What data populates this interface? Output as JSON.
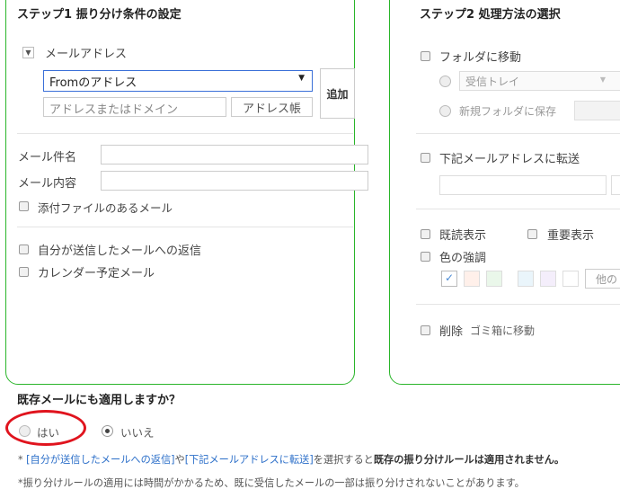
{
  "step1": {
    "title": "ステップ1 振り分け条件の設定",
    "mail_address_label": "メールアドレス",
    "from_select_value": "Fromのアドレス",
    "address_input_placeholder": "アドレスまたはドメイン",
    "address_book_button": "アドレス帳",
    "add_button": "追加",
    "subject_label": "メール件名",
    "content_label": "メール内容",
    "attachment_label": "添付ファイルのあるメール",
    "reply_label": "自分が送信したメールへの返信",
    "calendar_label": "カレンダー予定メール"
  },
  "step2": {
    "title": "ステップ2 処理方法の選択",
    "move_folder_label": "フォルダに移動",
    "inbox_select_value": "受信トレイ",
    "new_folder_label": "新規フォルダに保存",
    "forward_label": "下記メールアドレスに転送",
    "read_label": "既読表示",
    "important_label": "重要表示",
    "color_label": "色の強調",
    "color_other_button": "他の",
    "delete_label": "削除",
    "delete_sub": "ゴミ箱に移動",
    "swatch_colors": [
      "#ffffff",
      "#fff0ea",
      "#eaf7ea",
      "#eaf5fb",
      "#f4eefb",
      "#ffffff"
    ]
  },
  "apply": {
    "question": "既存メールにも適用しますか？",
    "yes_label": "はい",
    "no_label": "いいえ",
    "selected": "no"
  },
  "notes": {
    "n1_prefix": "* ",
    "n1_link1": "[自分が送信したメールへの返信]",
    "n1_mid": "や",
    "n1_link2": "[下記メールアドレスに転送]",
    "n1_mid2": "を選択すると",
    "n1_bold": "既存の振り分けルールは適用されません。",
    "n2": "*振り分けルールの適用には時間がかかるため、既に受信したメールの一部は振り分けされないことがあります。"
  },
  "colors": {
    "panel_border": "#2ab52a",
    "annotation": "#e0141e",
    "link": "#2c6fc9"
  }
}
